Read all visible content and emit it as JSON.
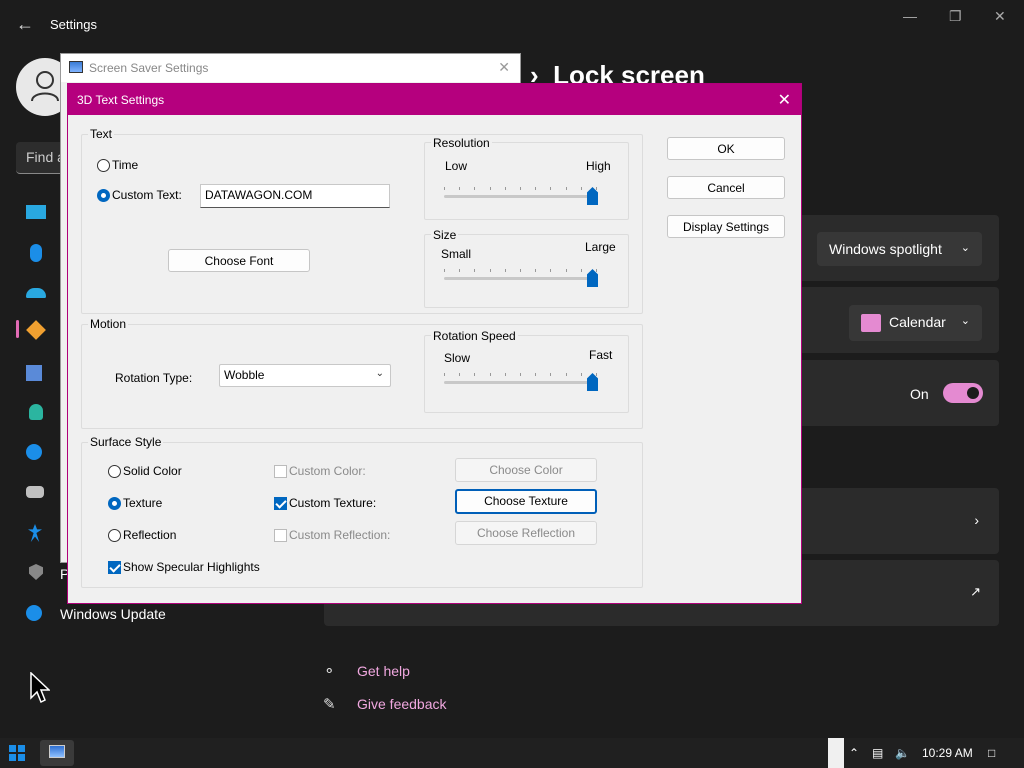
{
  "settings": {
    "title": "Settings",
    "search_placeholder": "Find a",
    "page_heading": "Lock screen",
    "partial_nav_letter": "P",
    "windows_update": "Windows Update",
    "personalize_dropdown": "Windows spotlight",
    "status_app_dropdown": "Calendar",
    "toggle_label": "On",
    "get_help": "Get help",
    "give_feedback": "Give feedback"
  },
  "screensaver": {
    "title": "Screen Saver Settings"
  },
  "dialog": {
    "title": "3D Text Settings",
    "text_group": "Text",
    "time_label": "Time",
    "custom_text_label": "Custom Text:",
    "custom_text_value": "DATAWAGON.COM",
    "choose_font": "Choose Font",
    "resolution_group": "Resolution",
    "resolution_low": "Low",
    "resolution_high": "High",
    "resolution_level": 1.0,
    "size_group": "Size",
    "size_small": "Small",
    "size_large": "Large",
    "size_level": 1.0,
    "motion_group": "Motion",
    "rotation_type_label": "Rotation Type:",
    "rotation_type_value": "Wobble",
    "rotation_speed_group": "Rotation Speed",
    "speed_slow": "Slow",
    "speed_fast": "Fast",
    "speed_level": 1.0,
    "surface_group": "Surface Style",
    "solid_color": "Solid Color",
    "texture": "Texture",
    "reflection": "Reflection",
    "custom_color": "Custom Color:",
    "custom_texture": "Custom Texture:",
    "custom_reflection": "Custom Reflection:",
    "choose_color": "Choose Color",
    "choose_texture": "Choose Texture",
    "choose_reflection": "Choose Reflection",
    "specular": "Show Specular Highlights",
    "ok": "OK",
    "cancel": "Cancel",
    "display_settings": "Display Settings"
  },
  "taskbar": {
    "time": "10:29 AM"
  },
  "colors": {
    "accent_titlebar": "#b5007e",
    "selection_blue": "#0067c0",
    "settings_accent": "#e48ad1"
  }
}
